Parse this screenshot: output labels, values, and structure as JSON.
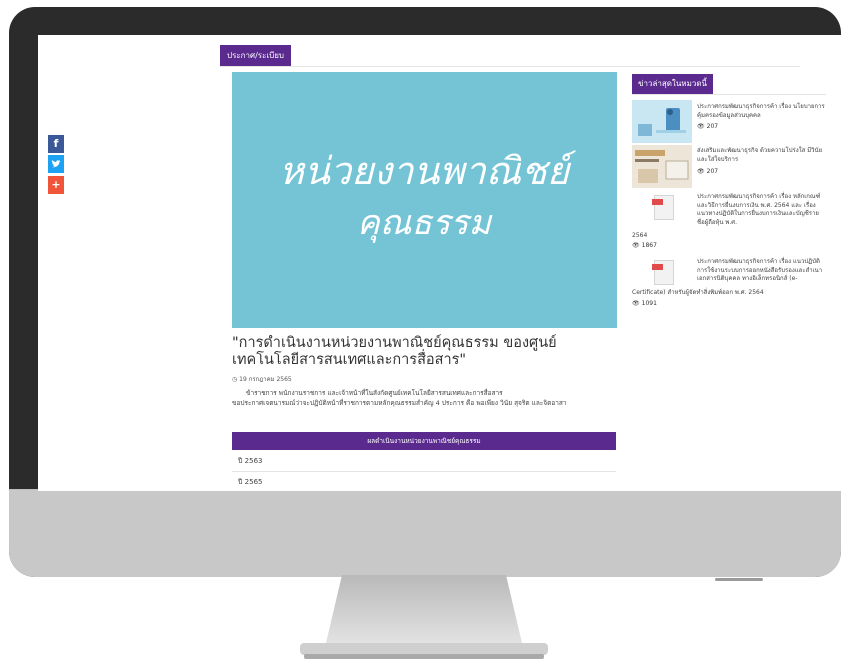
{
  "page": {
    "category_tab": "ประกาศ/ระเบียบ",
    "hero_text_line1": "หน่วยงานพาณิชย์",
    "hero_text_line2": "คุณธรรม",
    "article": {
      "title": "\"การดำเนินงานหน่วยงานพาณิชย์คุณธรรม ของศูนย์เทคโนโลยีสารสนเทศและการสื่อสาร\"",
      "date": "19 กรกฎาคม 2565",
      "body_line1": "ข้าราชการ พนักงานราชการ และเจ้าหน้าที่ในสังกัดศูนย์เทคโนโลยีสารสนเทศและการสื่อสาร",
      "body_line2": "ขอประกาศเจตนารมณ์ว่าจะปฏิบัติหน้าที่ราชการตามหลักคุณธรรมสำคัญ 4 ประการ คือ พอเพียง วินัย สุจริต และจิตอาสา"
    },
    "results": {
      "header": "ผลดำเนินงานหน่วยงานพาณิชย์คุณธรรม",
      "rows": [
        "ปี 2563",
        "ปี 2565"
      ]
    }
  },
  "share": {
    "facebook": "f",
    "twitter": "t",
    "plus": "+"
  },
  "sidebar": {
    "heading": "ข่าวล่าสุดในหมวดนี้",
    "items": [
      {
        "title": "ประกาศกรมพัฒนาธุรกิจการค้า เรื่อง นโยบายการคุ้มครองข้อมูลส่วนบุคคล",
        "views": "207"
      },
      {
        "title": "ส่งเสริมและพัฒนาธุรกิจ ด้วยความโปร่งใส มีวินัย และใส่ใจบริการ",
        "views": "207"
      },
      {
        "title_line1": "ประกาศกรมพัฒนาธุรกิจการค้า เรื่อง หลักเกณฑ์และวิธีการยื่นงบการเงิน พ.ศ. 2564 และ เรื่อง แนวทางปฏิบัติในการยื่นงบการเงินและบัญชีรายชื่อผู้ถือหุ้น พ.ศ.",
        "title_line2": "2564",
        "views": "1867"
      },
      {
        "title_line1": "ประกาศกรมพัฒนาธุรกิจการค้า เรื่อง แนวปฏิบัติการใช้งานระบบการออกหนังสือรับรองและสำเนาเอกสารนิติบุคคล ทางอิเล็กทรอนิกส์ (e-",
        "title_line2": "Certificate) สำหรับผู้จัดทำสิ่งพิมพ์ออก พ.ศ. 2564",
        "views": "1091"
      }
    ]
  },
  "colors": {
    "accent": "#5b2a8f",
    "hero_bg": "#74c4d6",
    "facebook": "#3b5998",
    "twitter": "#1da1f2",
    "plus": "#f0553a",
    "bezel": "#2b2b2b",
    "chin": "#c8c8c8"
  },
  "icons": {
    "eye": "eye-icon",
    "clock": "clock-icon",
    "pdf": "pdf-file-icon"
  }
}
